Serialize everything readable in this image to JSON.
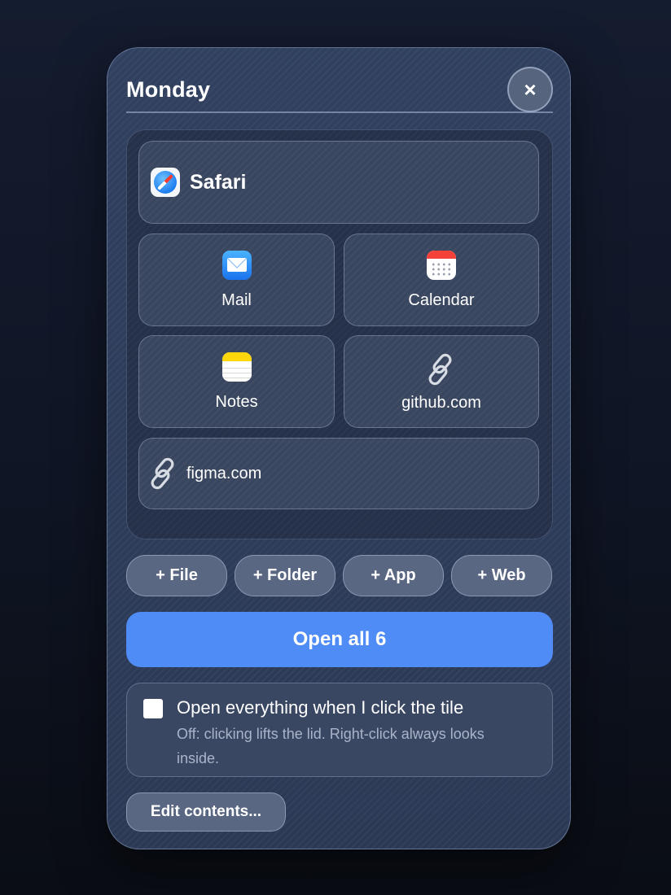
{
  "panel": {
    "title": "Monday",
    "close_label": "×"
  },
  "items": {
    "safari": {
      "label": "Safari",
      "icon": "safari-icon"
    },
    "mail": {
      "label": "Mail",
      "icon": "mail-icon"
    },
    "calendar": {
      "label": "Calendar",
      "icon": "calendar-icon"
    },
    "notes": {
      "label": "Notes",
      "icon": "notes-icon"
    },
    "github": {
      "label": "github.com",
      "icon": "link-icon"
    },
    "figma": {
      "label": "figma.com",
      "icon": "link-icon"
    }
  },
  "add_buttons": {
    "file": "+ File",
    "folder": "+ Folder",
    "app": "+ App",
    "web": "+ Web"
  },
  "open_all_label": "Open all 6",
  "option": {
    "checked": false,
    "title": "Open everything when I click the tile",
    "description": "Off: clicking lifts the lid. Right-click always looks inside."
  },
  "edit_label": "Edit contents...",
  "colors": {
    "accent": "#4f8cf6",
    "panel": "#2c3a56"
  }
}
